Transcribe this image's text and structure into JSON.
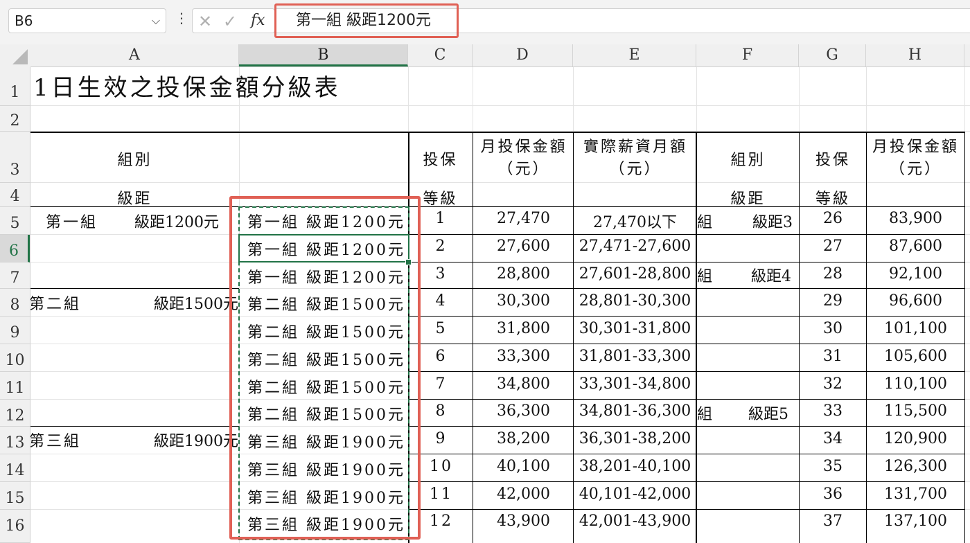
{
  "formula_bar": {
    "name_box": "B6",
    "more_icon": "⋮",
    "cancel_icon": "✕",
    "enter_icon": "✓",
    "fx_label": "fx",
    "formula_value": "第一組 級距1200元"
  },
  "columns": [
    {
      "label": "A"
    },
    {
      "label": "B"
    },
    {
      "label": "C"
    },
    {
      "label": "D"
    },
    {
      "label": "E"
    },
    {
      "label": "F"
    },
    {
      "label": "G"
    },
    {
      "label": "H"
    }
  ],
  "rows": [
    "1",
    "2",
    "3",
    "4",
    "5",
    "6",
    "7",
    "8",
    "9",
    "10",
    "11",
    "12",
    "13",
    "14",
    "15",
    "16"
  ],
  "sheet": {
    "title": "1日生效之投保金額分級表",
    "header": {
      "group": "組別",
      "range": "級距",
      "grade_top": "投保",
      "grade_bottom": "等級",
      "monthly": "月投保金額（元）",
      "salary": "實際薪資月額（元）"
    },
    "a_groups": [
      {
        "left": "第一組",
        "right": "級距1200元"
      },
      {
        "left": "第二組",
        "right": "級距1500元"
      },
      {
        "left": "第三組",
        "right": "級距1900元"
      }
    ],
    "b_values": [
      "第一組 級距1200元",
      "第一組 級距1200元",
      "第一組 級距1200元",
      "第二組 級距1500元",
      "第二組 級距1500元",
      "第二組 級距1500元",
      "第二組 級距1500元",
      "第二組 級距1500元",
      "第三組 級距1900元",
      "第三組 級距1900元",
      "第三組 級距1900元",
      "第三組 級距1900元"
    ],
    "grades": [
      "1",
      "2",
      "3",
      "4",
      "5",
      "6",
      "7",
      "8",
      "9",
      "10",
      "11",
      "12"
    ],
    "amounts": [
      "27,470",
      "27,600",
      "28,800",
      "30,300",
      "31,800",
      "33,300",
      "34,800",
      "36,300",
      "38,200",
      "40,100",
      "42,000",
      "43,900"
    ],
    "salaries": [
      "27,470以下",
      "27,471-27,600",
      "27,601-28,800",
      "28,801-30,300",
      "30,301-31,800",
      "31,801-33,300",
      "33,301-34,800",
      "34,801-36,300",
      "36,301-38,200",
      "38,201-40,100",
      "40,101-42,000",
      "42,001-43,900"
    ],
    "f_groups": [
      {
        "left": "組",
        "right": "級距3"
      },
      {
        "left": "組",
        "right": "級距4"
      },
      {
        "left": "組",
        "right": "級距5"
      }
    ],
    "grades_g": [
      "26",
      "27",
      "28",
      "29",
      "30",
      "31",
      "32",
      "33",
      "34",
      "35",
      "36",
      "37"
    ],
    "amounts_h": [
      "83,900",
      "87,600",
      "92,100",
      "96,600",
      "101,100",
      "105,600",
      "110,100",
      "115,500",
      "120,900",
      "126,300",
      "131,700",
      "137,100"
    ]
  }
}
